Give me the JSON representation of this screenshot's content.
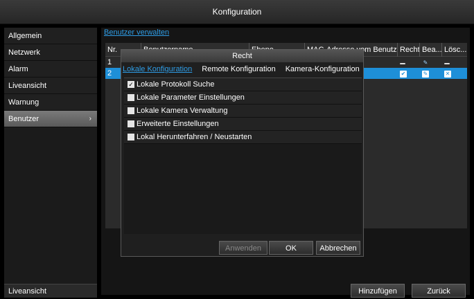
{
  "window": {
    "title": "Konfiguration"
  },
  "sidebar": {
    "items": [
      {
        "label": "Allgemein"
      },
      {
        "label": "Netzwerk"
      },
      {
        "label": "Alarm"
      },
      {
        "label": "Liveansicht"
      },
      {
        "label": "Warnung"
      },
      {
        "label": "Benutzer",
        "chevron": "›"
      }
    ],
    "bottom_label": "Liveansicht"
  },
  "main": {
    "tab_label": "Benutzer verwalten",
    "table": {
      "headers": [
        "Nr.",
        "Benutzername",
        "Ebene",
        "MAC-Adresse vom Benutzer",
        "Recht",
        "Bea...",
        "Lösc..."
      ],
      "rows": [
        {
          "nr": "1"
        },
        {
          "nr": "2"
        }
      ]
    },
    "buttons": {
      "add": "Hinzufügen",
      "back": "Zurück"
    }
  },
  "dialog": {
    "title": "Recht",
    "tabs": [
      "Lokale Konfiguration",
      "Remote Konfiguration",
      "Kamera-Konfiguration"
    ],
    "options": [
      {
        "label": "Lokale Protokoll Suche",
        "checked": true
      },
      {
        "label": "Lokale Parameter Einstellungen",
        "checked": false
      },
      {
        "label": "Lokale Kamera Verwaltung",
        "checked": false
      },
      {
        "label": "Erweiterte Einstellungen",
        "checked": false
      },
      {
        "label": "Lokal Herunterfahren / Neustarten",
        "checked": false
      }
    ],
    "buttons": {
      "apply": "Anwenden",
      "ok": "OK",
      "cancel": "Abbrechen"
    }
  },
  "colors": {
    "accent": "#2f9ee8",
    "selected_row": "#1e8fd8"
  }
}
